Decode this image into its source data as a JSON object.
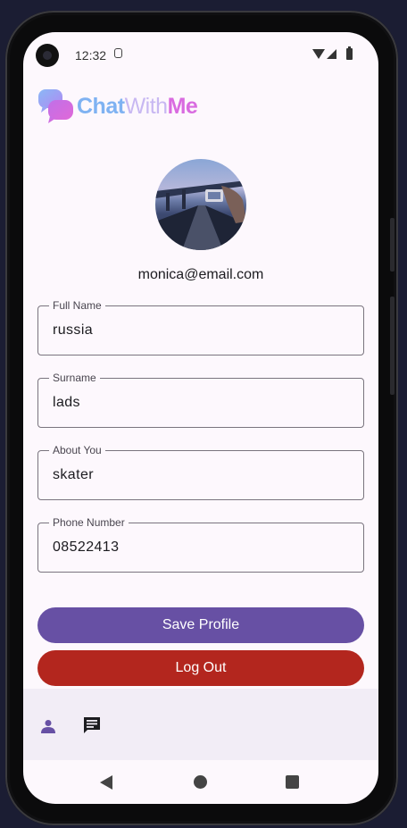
{
  "status_bar": {
    "time": "12:32"
  },
  "logo": {
    "part1": "Chat",
    "part2": "With",
    "part3": "Me"
  },
  "profile": {
    "email": "monica@email.com"
  },
  "fields": [
    {
      "label": "Full Name",
      "value": "russia"
    },
    {
      "label": "Surname",
      "value": "lads"
    },
    {
      "label": "About You",
      "value": "skater"
    },
    {
      "label": "Phone Number",
      "value": "08522413"
    }
  ],
  "buttons": {
    "save": "Save Profile",
    "logout": "Log Out"
  },
  "colors": {
    "primary": "#6750a4",
    "danger": "#b3261e",
    "nav_bg": "#f2edf6"
  },
  "bottom_nav": {
    "items": [
      "person-icon",
      "chat-icon"
    ],
    "selected": "person-icon"
  },
  "system_nav": {
    "items": [
      "back-icon",
      "home-icon",
      "recents-icon"
    ]
  }
}
